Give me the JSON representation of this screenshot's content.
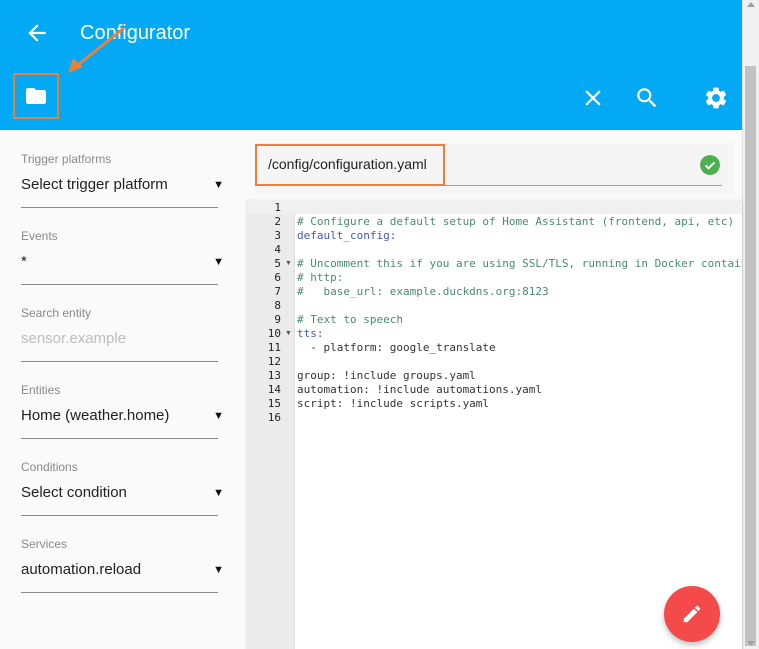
{
  "header": {
    "title": "Configurator",
    "back_icon": "arrow-left-icon"
  },
  "toolbar": {
    "folder_icon": "folder-icon",
    "close_icon": "close-icon",
    "search_icon": "search-icon",
    "settings_icon": "gear-icon"
  },
  "sidebar": {
    "trigger": {
      "label": "Trigger platforms",
      "value": "Select trigger platform"
    },
    "events": {
      "label": "Events",
      "value": "*"
    },
    "search_entity": {
      "label": "Search entity",
      "placeholder": "sensor.example"
    },
    "entities": {
      "label": "Entities",
      "value": "Home (weather.home)"
    },
    "conditions": {
      "label": "Conditions",
      "value": "Select condition"
    },
    "services": {
      "label": "Services",
      "value": "automation.reload"
    }
  },
  "editor": {
    "file_path": "/config/configuration.yaml",
    "status_icon": "check-circle-icon",
    "line_numbers": [
      "1",
      "2",
      "3",
      "4",
      "5",
      "6",
      "7",
      "8",
      "9",
      "10",
      "11",
      "12",
      "13",
      "14",
      "15",
      "16"
    ],
    "lines": [
      "",
      "# Configure a default setup of Home Assistant (frontend, api, etc)",
      "default_config:",
      "",
      "# Uncomment this if you are using SSL/TLS, running in Docker container, etc.",
      "# http:",
      "#   base_url: example.duckdns.org:8123",
      "",
      "# Text to speech",
      "tts:",
      "  - platform: google_translate",
      "",
      "group: !include groups.yaml",
      "automation: !include automations.yaml",
      "script: !include scripts.yaml",
      ""
    ]
  },
  "fab": {
    "icon": "pencil-icon"
  },
  "colors": {
    "primary": "#03a9f4",
    "accent": "#f44a4a",
    "annotation": "#e8803a",
    "success": "#4caf50"
  }
}
